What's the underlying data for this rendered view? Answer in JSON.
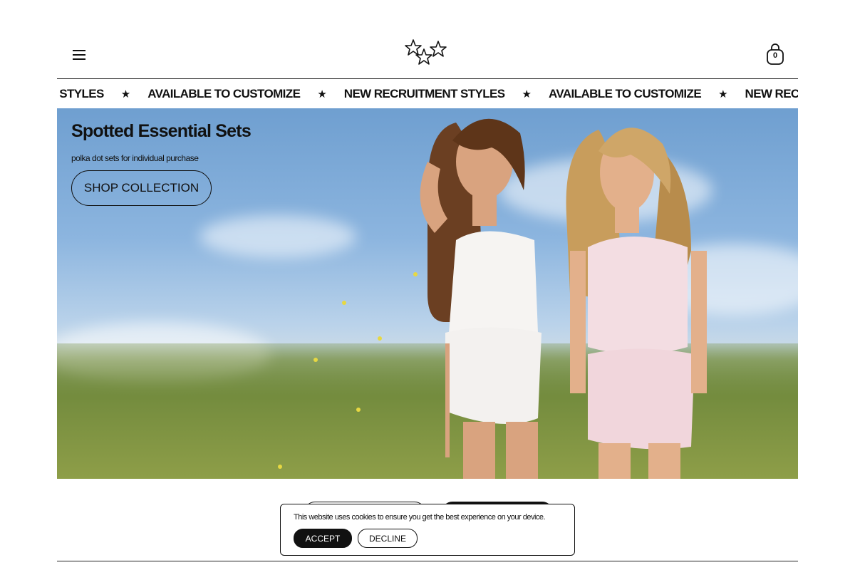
{
  "header": {
    "menu_icon": "hamburger-menu-icon",
    "logo_icon": "stars-logo-icon",
    "cart_icon": "shopping-bag-icon",
    "cart_count": "0"
  },
  "announcement_bar": {
    "items": [
      "NEW RECRUITMENT STYLES",
      "AVAILABLE TO CUSTOMIZE",
      "NEW RECRUITMENT STYLES",
      "AVAILABLE TO CUSTOMIZE",
      "NEW RECRUITMENT STYLES"
    ],
    "separator": "★"
  },
  "hero": {
    "title": "Spotted Essential Sets",
    "subtitle": "polka dot sets for individual purchase",
    "cta_label": "SHOP COLLECTION"
  },
  "cookie_banner": {
    "message": "This website uses cookies to ensure you get the best experience on your device.",
    "accept_label": "ACCEPT",
    "decline_label": "DECLINE"
  },
  "colors": {
    "text": "#111111",
    "background": "#ffffff",
    "accept_bg": "#111111"
  }
}
